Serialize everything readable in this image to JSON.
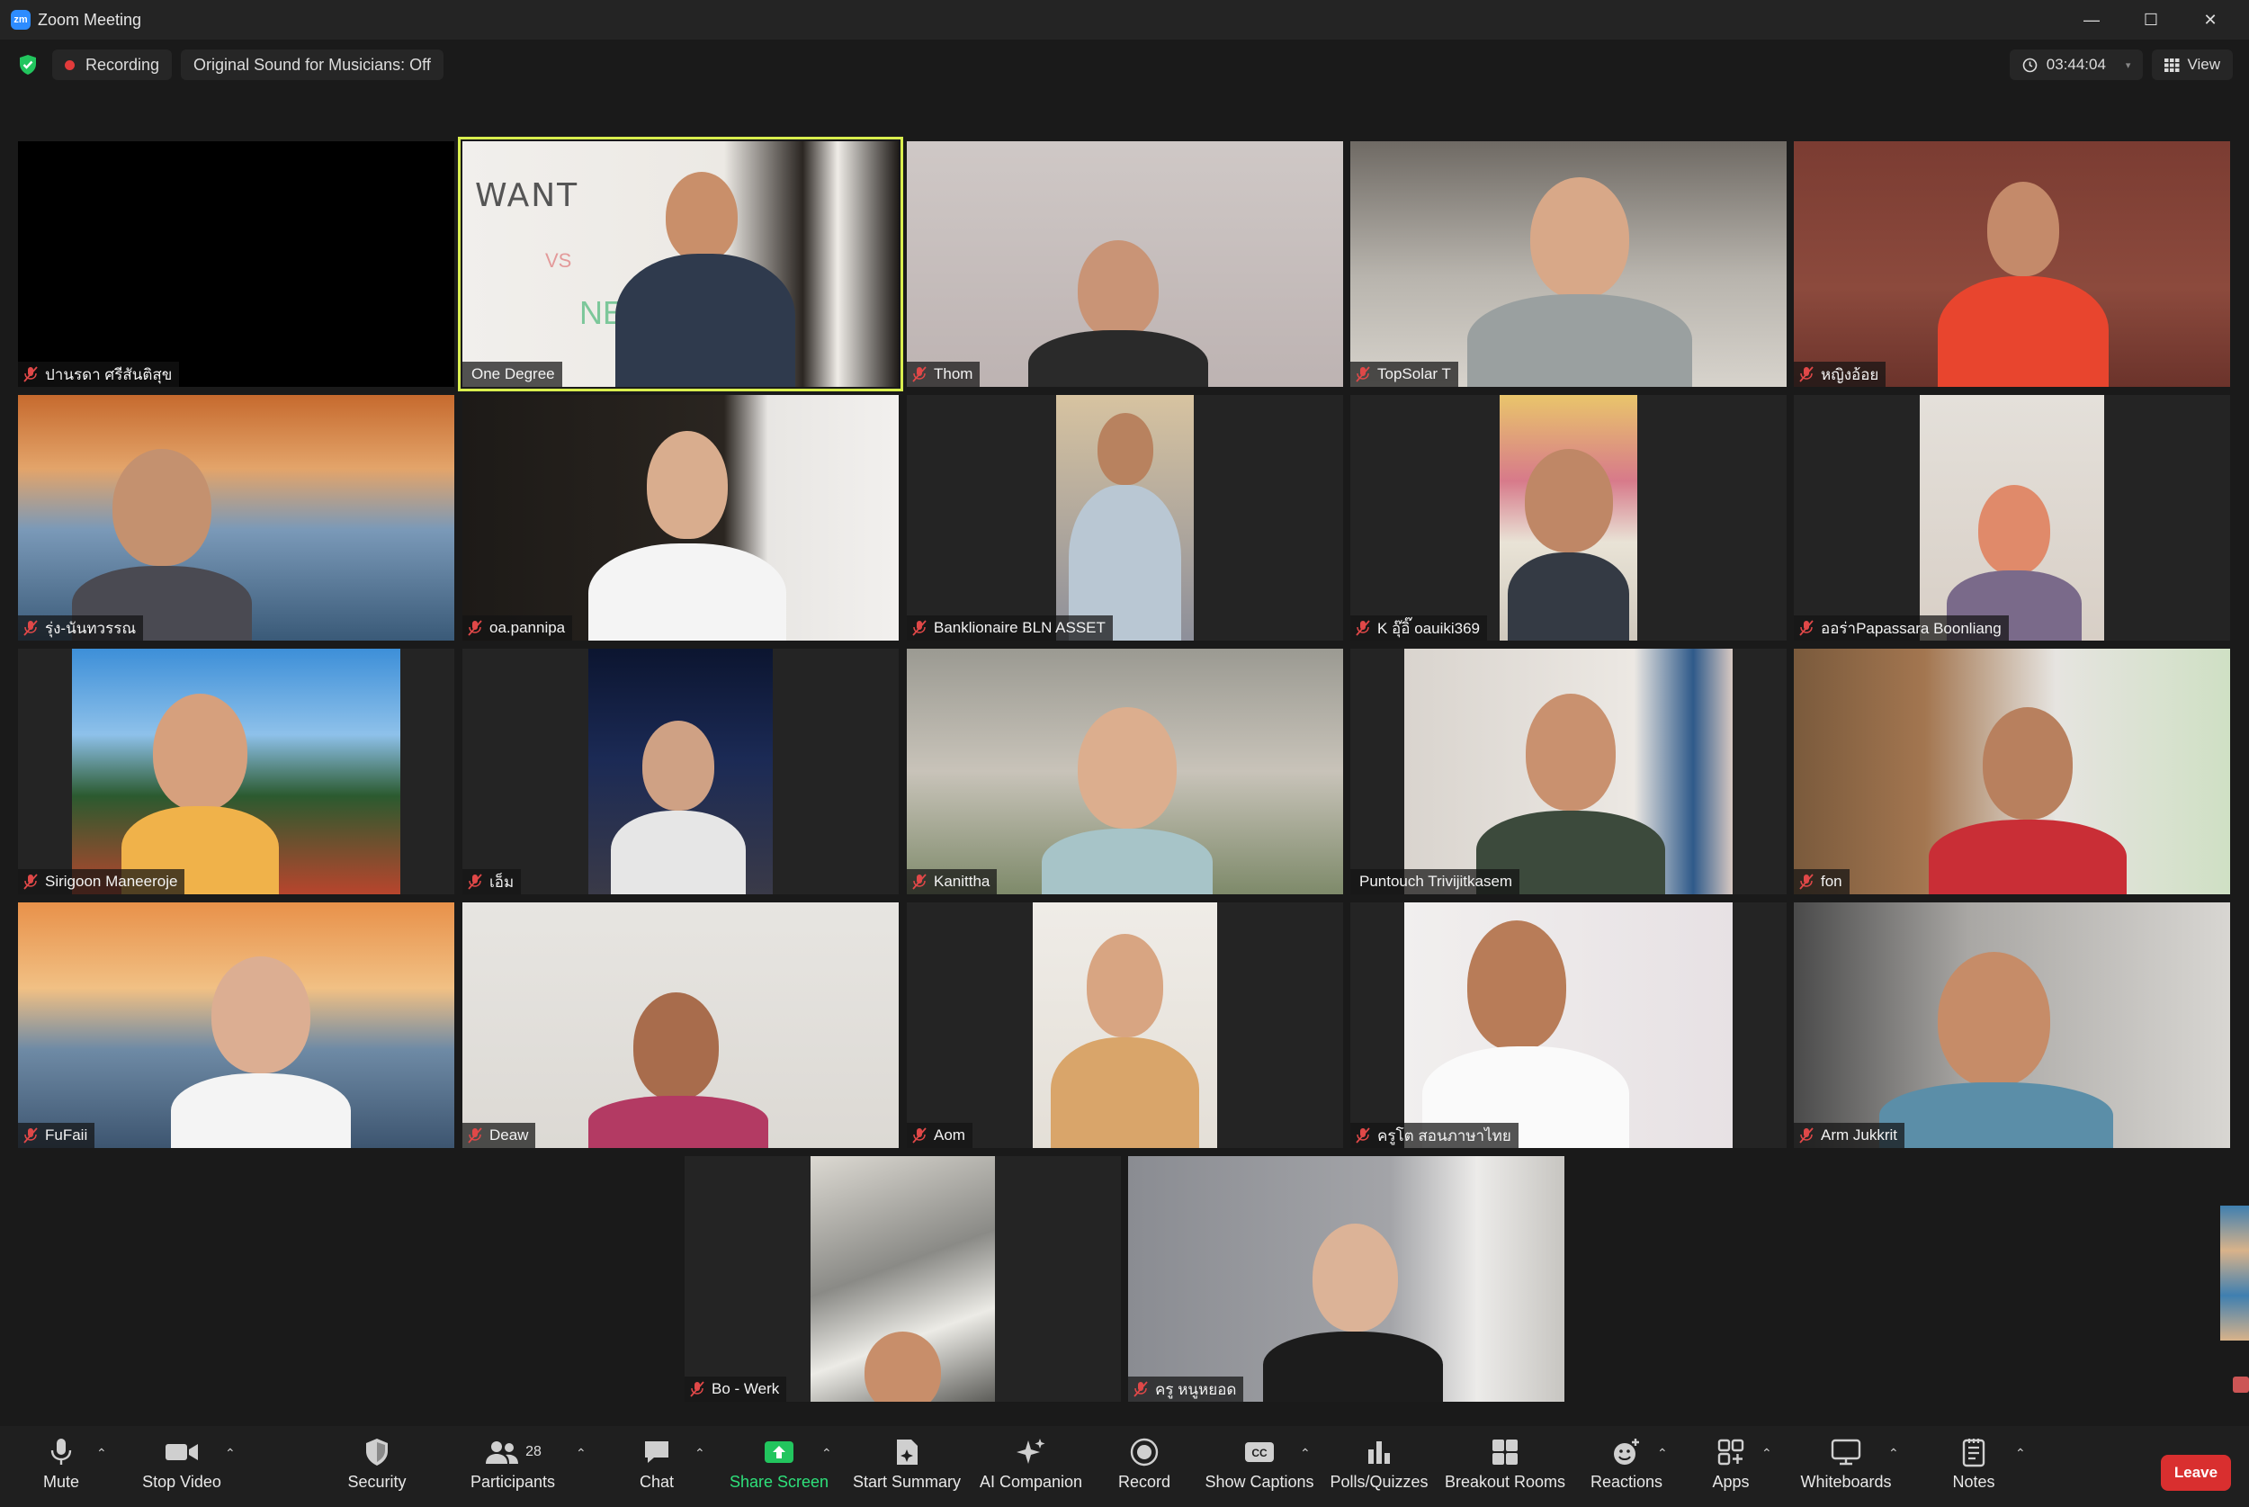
{
  "window": {
    "title": "Zoom Meeting",
    "logo": "zm"
  },
  "status": {
    "recording": "Recording",
    "original_sound": "Original Sound for Musicians: Off",
    "timer": "03:44:04",
    "view": "View"
  },
  "participants": [
    {
      "name": "ปานรดา ศรีสันติสุข"
    },
    {
      "name": "One Degree"
    },
    {
      "name": "Thom"
    },
    {
      "name": "TopSolar T"
    },
    {
      "name": "หญิงอ้อย"
    },
    {
      "name": "รุ่ง-นันทวรรณ"
    },
    {
      "name": "oa.pannipa"
    },
    {
      "name": "Banklionaire BLN ASSET"
    },
    {
      "name": "K อุ๊อิ๊ oauiki369"
    },
    {
      "name": "ออร่าPapassara Boonliang"
    },
    {
      "name": "Sirigoon Maneeroje"
    },
    {
      "name": "เอ็ม"
    },
    {
      "name": "Kanittha"
    },
    {
      "name": "Puntouch Trivijitkasem"
    },
    {
      "name": "fon"
    },
    {
      "name": "FuFaii"
    },
    {
      "name": "Deaw"
    },
    {
      "name": "Aom"
    },
    {
      "name": "ครูโต สอนภาษาไทย"
    },
    {
      "name": "Arm Jukkrit"
    },
    {
      "name": "Bo - Werk"
    },
    {
      "name": "ครู หนูหยอด"
    }
  ],
  "whiteboard_text": {
    "line1": "WANT",
    "line2": "VS",
    "line3": "NE"
  },
  "toolbar": {
    "mute": "Mute",
    "stop_video": "Stop Video",
    "security": "Security",
    "participants": "Participants",
    "participants_count": "28",
    "chat": "Chat",
    "share_screen": "Share Screen",
    "start_summary": "Start Summary",
    "ai_companion": "AI Companion",
    "record": "Record",
    "show_captions": "Show Captions",
    "polls": "Polls/Quizzes",
    "breakout": "Breakout Rooms",
    "reactions": "Reactions",
    "apps": "Apps",
    "whiteboards": "Whiteboards",
    "notes": "Notes",
    "leave": "Leave"
  },
  "colors": {
    "accent_green": "#2ee07a",
    "leave_red": "#d92f2f",
    "speaker_border": "#d9ee4e",
    "rec_red": "#e23b3b"
  }
}
